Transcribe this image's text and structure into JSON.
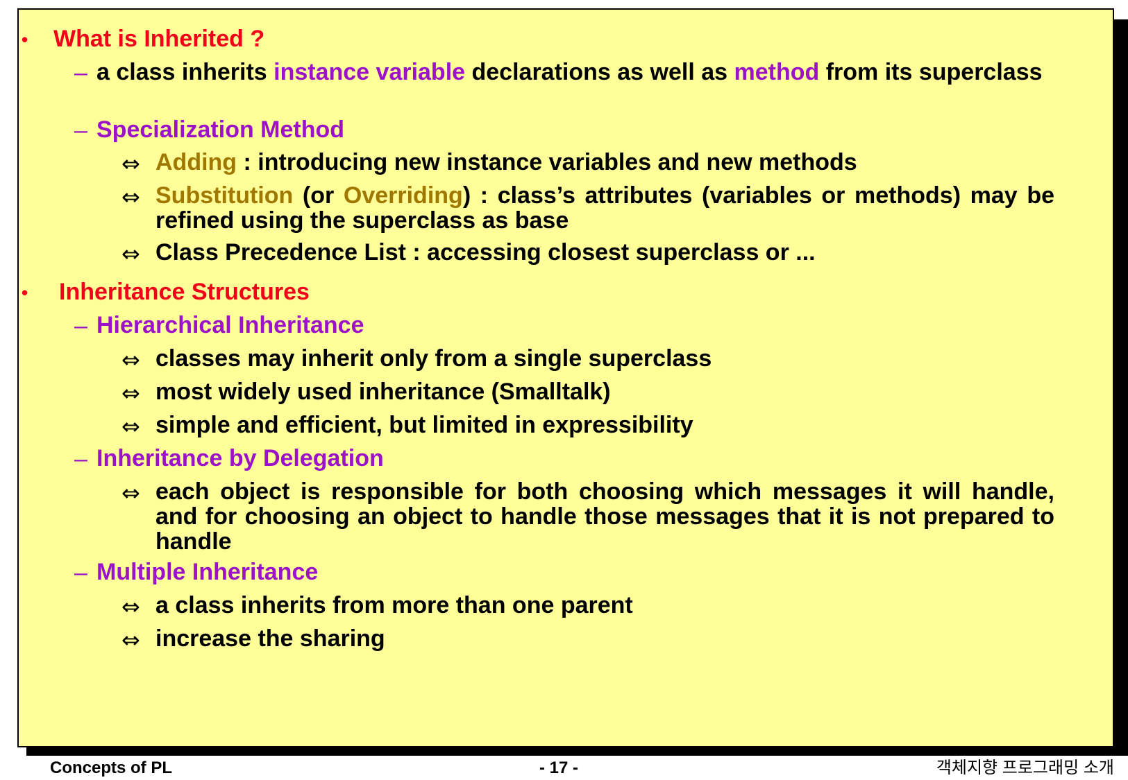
{
  "sections": [
    {
      "heading": "What is Inherited ?",
      "items": [
        {
          "parts": [
            "a class inherits ",
            "instance variable",
            " declarations as well as ",
            "method",
            " from its superclass"
          ]
        },
        {
          "title": "Specialization Method",
          "subitems": [
            {
              "parts": [
                "Adding",
                "  :  introducing new instance variables and new methods"
              ]
            },
            {
              "parts": [
                "Substitution",
                " (or ",
                "Overriding",
                ") : class’s attributes (variables or methods) may be refined using the superclass as base"
              ]
            },
            {
              "text": "Class Precedence List : accessing closest superclass or ..."
            }
          ]
        }
      ]
    },
    {
      "heading": "Inheritance Structures",
      "items": [
        {
          "title": "Hierarchical Inheritance",
          "subitems": [
            {
              "text": "classes may inherit only from a single superclass"
            },
            {
              "text": "most widely used inheritance (Smalltalk)"
            },
            {
              "text": "simple and efficient, but limited in  expressibility"
            }
          ]
        },
        {
          "title": "Inheritance by Delegation",
          "subitems": [
            {
              "text": "each object is responsible for both choosing which messages it will handle, and  for choosing an object to handle those messages that it is not prepared to handle"
            }
          ]
        },
        {
          "title": "Multiple Inheritance",
          "subitems": [
            {
              "text": "a class inherits from more than one parent"
            },
            {
              "text": "increase the sharing"
            }
          ]
        }
      ]
    }
  ],
  "symbols": {
    "bullet": "•",
    "dash": "–",
    "arrow": "⇔"
  },
  "footer": {
    "left": "Concepts of PL",
    "center": "- 17 -",
    "right": "객체지향 프로그래밍 소개"
  },
  "colors": {
    "background": "#ffff99",
    "heading": "#f00019",
    "subheading": "#9b12c8",
    "keyword": "#a07800",
    "text": "#000000"
  }
}
